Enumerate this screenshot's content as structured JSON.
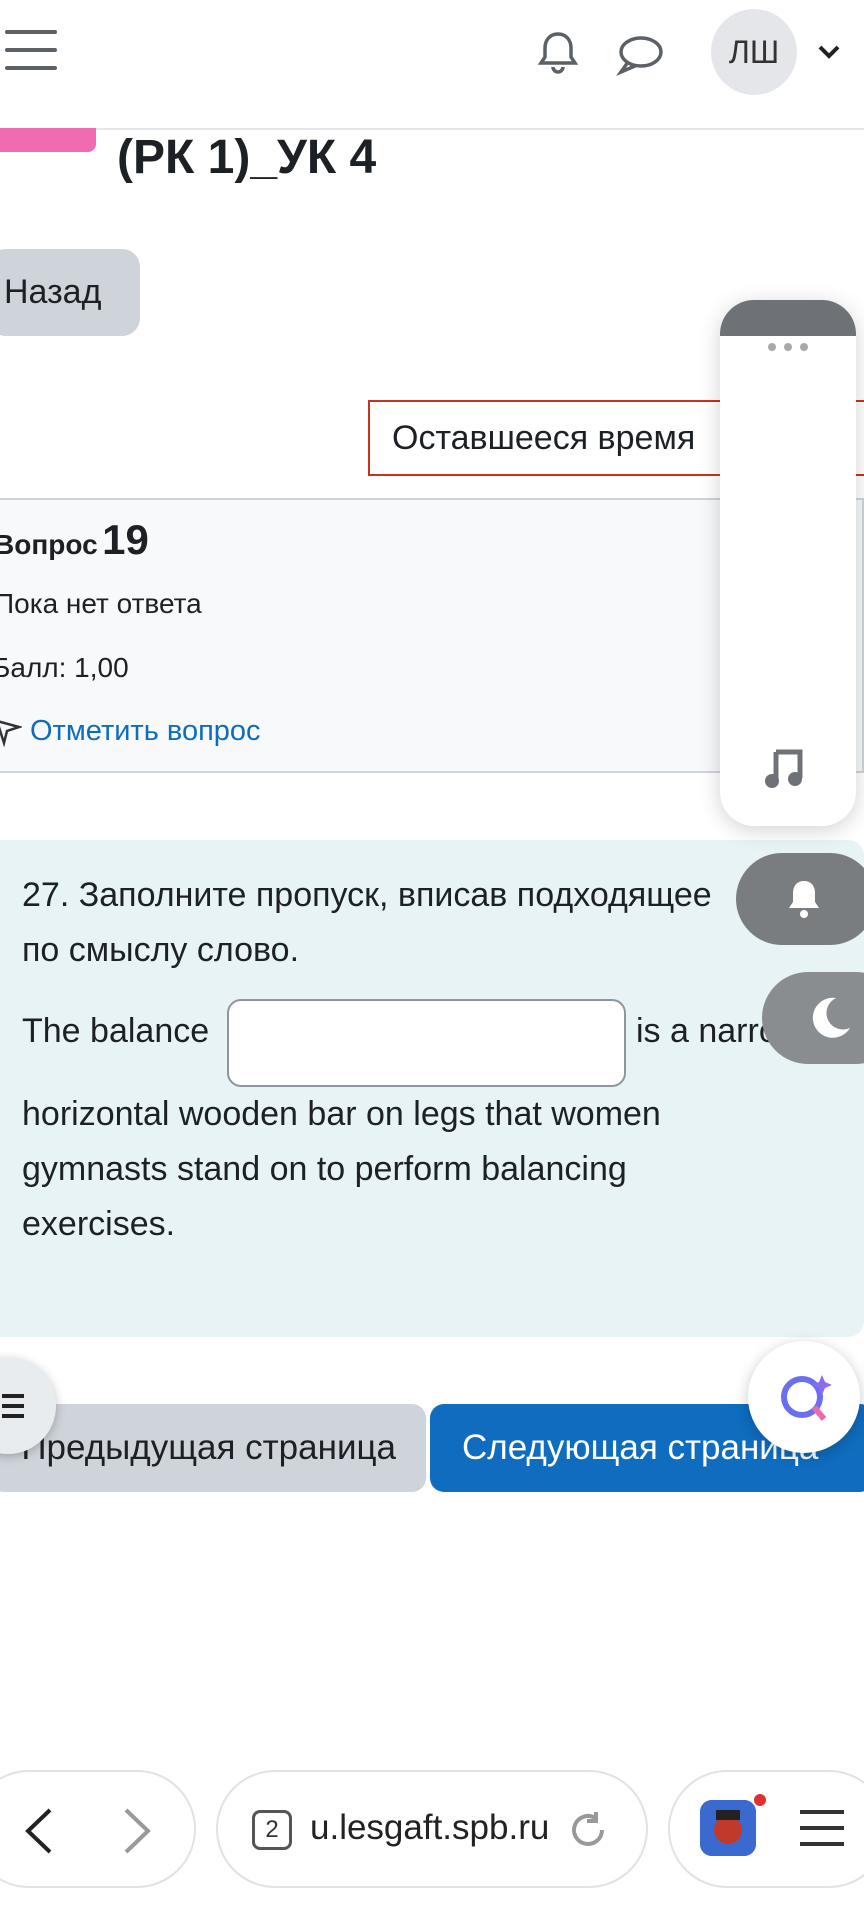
{
  "header": {
    "menu_icon": "hamburger-icon",
    "notifications_icon": "bell-icon",
    "messages_icon": "chat-bubble-icon",
    "user_initials": "ЛШ",
    "user_menu_icon": "chevron-down-icon"
  },
  "page": {
    "title": "(РК 1)_УК 4",
    "back_label": "Назад",
    "timer_label": "Оставшееся время"
  },
  "question_info": {
    "number_label": "Вопрос",
    "number": "19",
    "state": "Пока нет ответа",
    "grade": "Балл: 1,00",
    "flag_label": "Отметить вопрос"
  },
  "question": {
    "prompt": "27. Заполните пропуск, вписав подходящее по смыслу слово.",
    "text_before": "The balance",
    "answer_value": "",
    "text_after_line1": "is a narrow",
    "text_rest": "horizontal wooden bar on legs that women gymnasts stand on to perform balancing exercises."
  },
  "navigation": {
    "prev_label": "Предыдущая страница",
    "next_label": "Следующая страница"
  },
  "browser": {
    "tab_count": "2",
    "url": "u.lesgaft.spb.ru"
  },
  "colors": {
    "primary": "#0f6cbf",
    "timer_border": "#ca3120",
    "question_bg": "#e7f3f5",
    "accent_pink": "#f06bb0"
  }
}
